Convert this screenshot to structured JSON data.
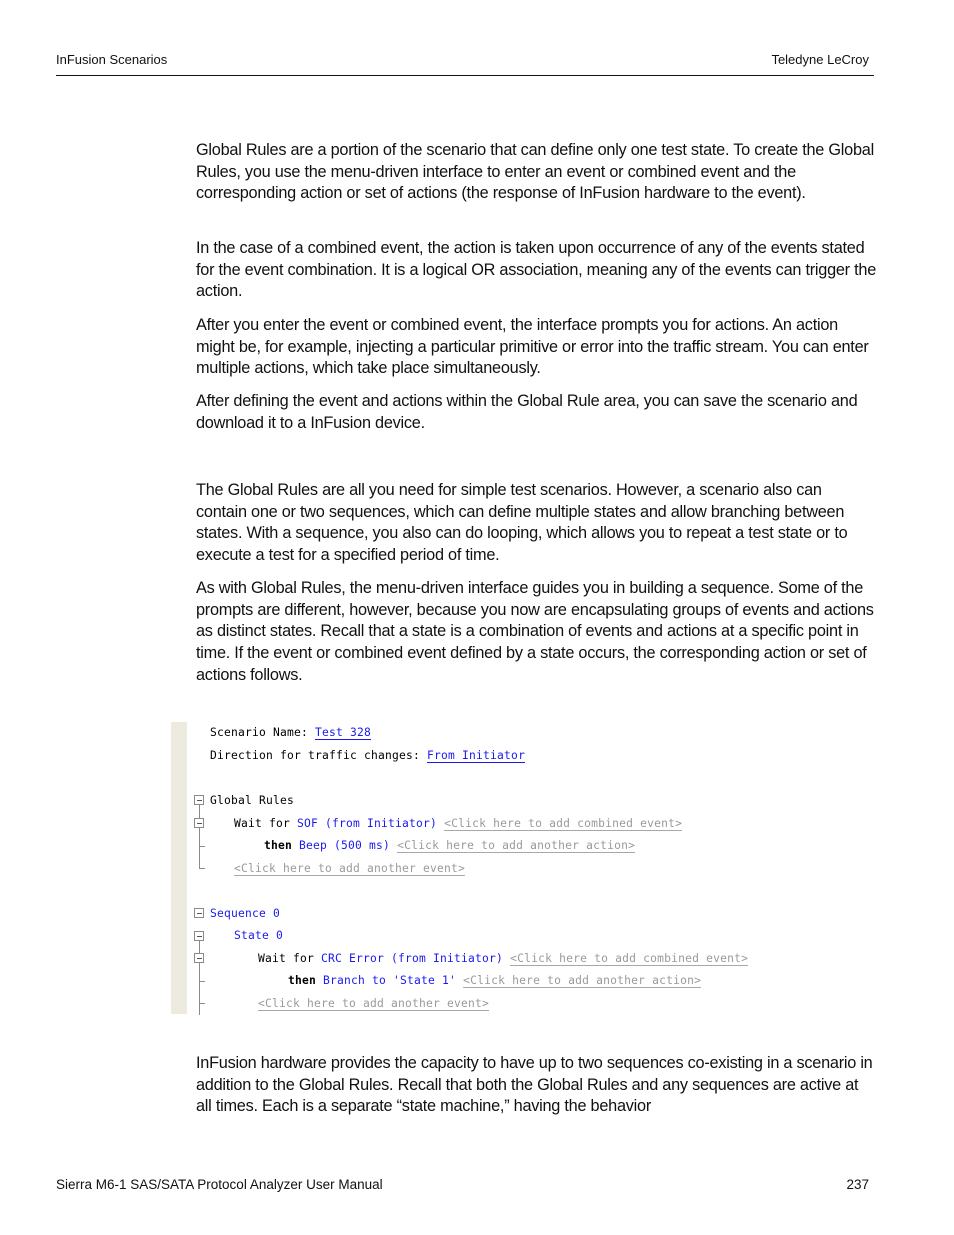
{
  "header": {
    "left": "InFusion Scenarios",
    "right": "Teledyne LeCroy"
  },
  "paragraphs": [
    "Global Rules are a portion of the scenario that can define only one test state. To create the Global Rules, you use the menu-driven interface to enter an event or combined event and the corresponding action or set of actions (the response of InFusion hardware to the event).",
    "In the case of a combined event, the action is taken upon occurrence of any of the events stated for the event combination. It is a logical OR association, meaning any of the events can trigger the action.",
    "After you enter the event or combined event, the interface prompts you for actions. An action might be, for example, injecting a particular primitive or error into the traffic stream. You can enter multiple actions, which take place simultaneously.",
    "After defining the event and actions within the Global Rule area, you can save the scenario and download it to a InFusion device.",
    "The Global Rules are all you need for simple test scenarios. However, a scenario also can contain one or two sequences, which can define multiple states and allow branching between states. With a sequence, you also can do looping, which allows you to repeat a test state or to execute a test for a specified period of time.",
    "As with Global Rules, the menu-driven interface guides you in building a sequence. Some of the prompts are different, however, because you now are encapsulating groups of events and actions as distinct states. Recall that a state is a combination of events and actions at a specific point in time. If the event or combined event defined by a state occurs, the corresponding action or set of actions follows.",
    "InFusion hardware provides the capacity to have up to two sequences co-existing in a scenario in addition to the Global Rules. Recall that both the Global Rules and any sequences are active at all times. Each is a separate “state machine,” having the behavior"
  ],
  "figure": {
    "scenario_name_label": "Scenario Name: ",
    "scenario_name_value": "Test 328",
    "direction_label": "Direction for traffic changes: ",
    "direction_value": "From Initiator",
    "global_rules": {
      "title": "Global Rules",
      "wait_for": "Wait for ",
      "event": "SOF (from Initiator)",
      "add_combined": "<Click here to add combined event>",
      "then": "then ",
      "action": "Beep (500 ms)",
      "add_action": "<Click here to add another action>",
      "add_event": "<Click here to add another event>"
    },
    "sequence": {
      "title": "Sequence 0",
      "state": "State 0",
      "wait_for": "Wait for ",
      "event": "CRC Error (from Initiator)",
      "add_combined": "<Click here to add combined event>",
      "then": "then ",
      "action": "Branch to 'State 1'",
      "add_action": "<Click here to add another action>",
      "add_event": "<Click here to add another event>"
    }
  },
  "footer": {
    "left": "Sierra M6-1 SAS/SATA Protocol Analyzer User Manual",
    "right": "237"
  }
}
